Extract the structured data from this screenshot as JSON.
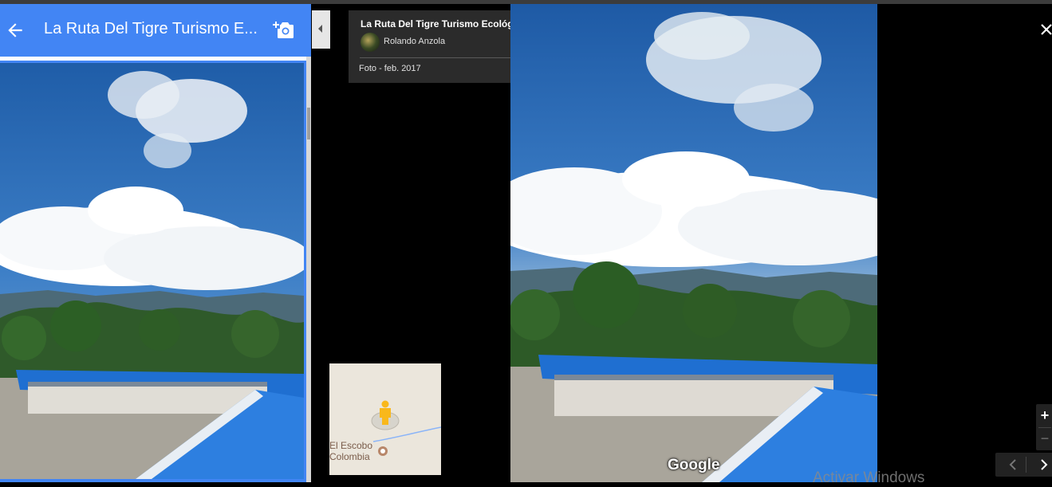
{
  "header": {
    "title": "La Ruta Del Tigre Turismo E...",
    "back_icon": "arrow-left-icon",
    "add_photo_icon": "add-photo-camera-icon",
    "color": "#4285f4"
  },
  "info_card": {
    "place_name": "La Ruta Del Tigre Turismo Ecológico",
    "author": "Rolando Anzola",
    "date_label": "Foto - feb. 2017",
    "icons": [
      "map-pin-icon",
      "more-vert-icon"
    ]
  },
  "minimap": {
    "label_line1": "El Escobo",
    "label_line2": "Colombia",
    "icon": "pegman-icon"
  },
  "main_view": {
    "watermark": "Google",
    "close_icon": "close-icon",
    "zoom_in": "+",
    "zoom_out": "−",
    "nav_icons": [
      "chevron-left-icon",
      "chevron-right-icon"
    ]
  },
  "system": {
    "activation_text": "Activar Windows"
  }
}
